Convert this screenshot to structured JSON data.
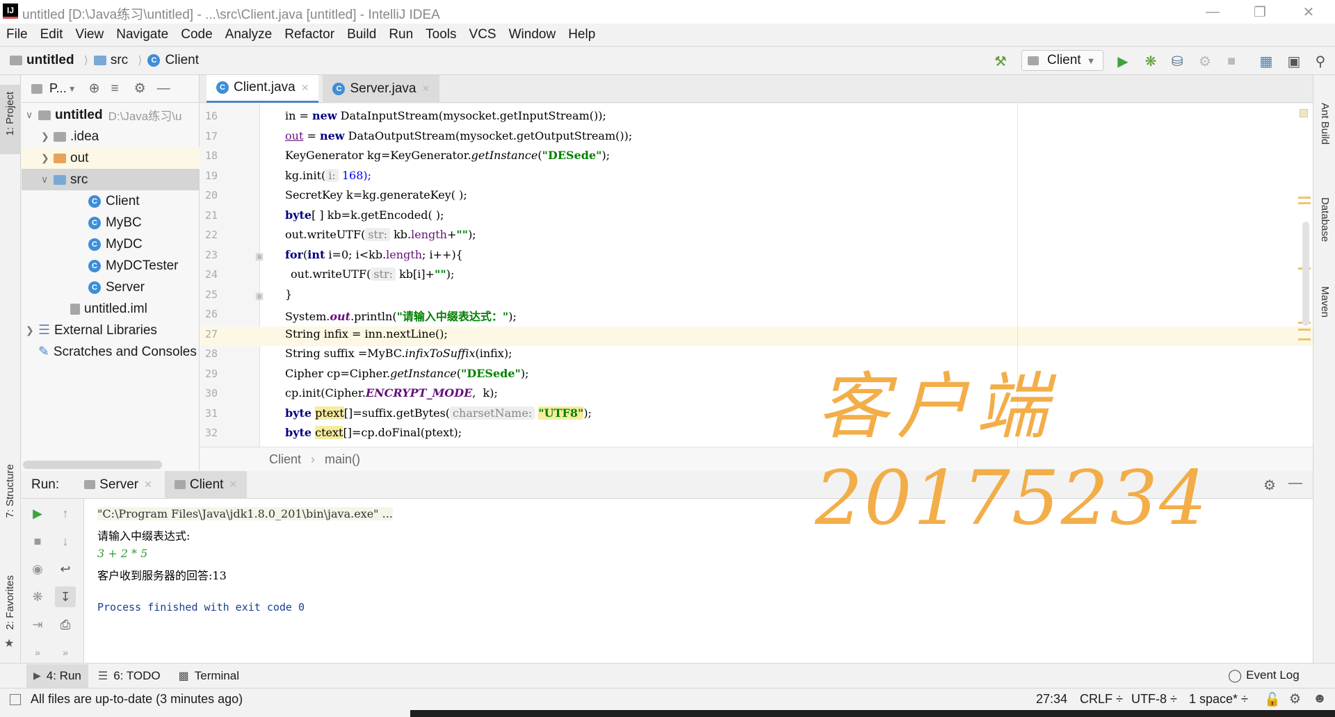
{
  "window": {
    "title": "untitled [D:\\Java练习\\untitled] - ...\\src\\Client.java [untitled] - IntelliJ IDEA",
    "logo_text": "IJ"
  },
  "menu": [
    "File",
    "Edit",
    "View",
    "Navigate",
    "Code",
    "Analyze",
    "Refactor",
    "Build",
    "Run",
    "Tools",
    "VCS",
    "Window",
    "Help"
  ],
  "navbar": {
    "crumbs": [
      "untitled",
      "src",
      "Client"
    ],
    "run_config": "Client"
  },
  "left_strip": {
    "project": "1: Project",
    "structure": "7: Structure",
    "favorites": "2: Favorites"
  },
  "right_strip": {
    "ant": "Ant Build",
    "database": "Database",
    "maven": "Maven"
  },
  "project": {
    "header_label": "P...",
    "root_name": "untitled",
    "root_path": "D:\\Java练习\\u",
    "items": [
      "idea",
      "out",
      "src",
      "Client",
      "MyBC",
      "MyDC",
      "MyDCTester",
      "Server",
      "untitled.iml",
      "External Libraries",
      "Scratches and Consoles"
    ]
  },
  "editor": {
    "tabs": [
      "Client.java",
      "Server.java"
    ],
    "line_numbers": [
      "16",
      "17",
      "18",
      "19",
      "20",
      "21",
      "22",
      "23",
      "24",
      "25",
      "26",
      "27",
      "28",
      "29",
      "30",
      "31",
      "32"
    ],
    "breadcrumb": [
      "Client",
      "main()"
    ]
  },
  "code": {
    "l16": [
      "in = ",
      "new",
      " DataInputStream(mysocket.getInputStream());"
    ],
    "l17": [
      "out",
      " = ",
      "new",
      " DataOutputStream(mysocket.getOutputStream());"
    ],
    "l18": [
      "KeyGenerator kg=KeyGenerator.",
      "getInstance",
      "(",
      "\"DESede\"",
      ");"
    ],
    "l19": [
      "kg.init(",
      "i:",
      " 168);"
    ],
    "l20": [
      "SecretKey k=kg.generateKey( );"
    ],
    "l21": [
      "byte",
      "[ ] kb=k.getEncoded( );"
    ],
    "l22": [
      "out.writeUTF(",
      "str:",
      " kb.",
      "length",
      "+",
      "\"\"",
      ");"
    ],
    "l23": [
      "for",
      "(",
      "int",
      " i=0; i<kb.",
      "length",
      "; i++){"
    ],
    "l24": [
      "out.writeUTF(",
      "str:",
      " kb[i]+",
      "\"\"",
      ");"
    ],
    "l25": [
      "}"
    ],
    "l26": [
      "System.",
      "out",
      ".println(",
      "\"请输入中缀表达式：\"",
      ");"
    ],
    "l27": [
      "String infix = inn.nextLine();"
    ],
    "l28": [
      "String suffix =MyBC.",
      "infixToSuffix",
      "(infix);"
    ],
    "l29": [
      "Cipher cp=Cipher.",
      "getInstance",
      "(",
      "\"DESede\"",
      ");"
    ],
    "l30": [
      "cp.init(Cipher.",
      "ENCRYPT_MODE",
      ",  k);"
    ],
    "l31": [
      "byte",
      " ",
      "ptext",
      "[]=suffix.getBytes(",
      "charsetName:",
      " ",
      "\"UTF8\"",
      ");"
    ],
    "l32": [
      "byte",
      " ",
      "ctext",
      "[]=cp.doFinal(ptext);"
    ]
  },
  "run": {
    "label": "Run:",
    "tabs": [
      "Server",
      "Client"
    ],
    "console": [
      "\"C:\\Program Files\\Java\\jdk1.8.0_201\\bin\\java.exe\" ...",
      "请输入中缀表达式:",
      "3 + 2 * 5",
      "客户收到服务器的回答:13",
      "Process finished with exit code 0"
    ]
  },
  "overlay": {
    "line1": "客户端",
    "line2": "20175234"
  },
  "bottom_tools": {
    "run": "4: Run",
    "todo": "6: TODO",
    "terminal": "Terminal",
    "event_log": "Event Log"
  },
  "status": {
    "message": "All files are up-to-date (3 minutes ago)",
    "position": "27:34",
    "line_sep": "CRLF ÷",
    "encoding": "UTF-8 ÷",
    "indent": "1 space* ÷"
  },
  "colors": {
    "keyword": "#000080",
    "string": "#008000",
    "overlay": "#f2a83a",
    "accent": "#4a86c7"
  }
}
